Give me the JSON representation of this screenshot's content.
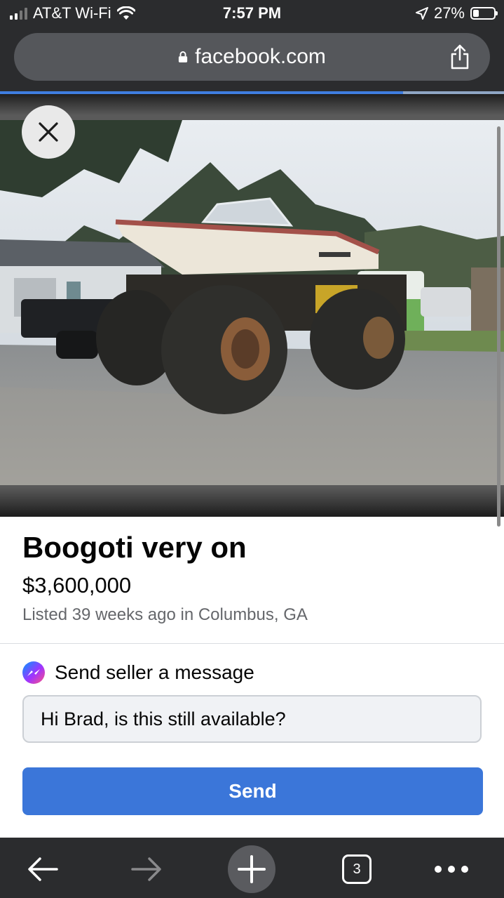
{
  "status": {
    "carrier": "AT&T Wi-Fi",
    "time": "7:57 PM",
    "battery": "27%",
    "battery_level": 0.27
  },
  "browser": {
    "url": "facebook.com",
    "page_load_progress": 0.8,
    "tab_count": "3"
  },
  "listing": {
    "title": "Boogoti very on",
    "price": "$3,600,000",
    "meta": "Listed 39 weeks ago in Columbus, GA"
  },
  "message": {
    "heading": "Send seller a message",
    "input_value": "Hi Brad, is this still available?",
    "send_label": "Send"
  },
  "colors": {
    "send_button": "#3b76d9",
    "chrome_bg": "#2b2c2e"
  },
  "icons": {
    "close": "close-icon",
    "back": "arrow-left-icon",
    "forward": "arrow-right-icon",
    "new_tab": "plus-icon",
    "more": "more-icon",
    "share": "share-icon",
    "lock": "lock-icon",
    "messenger": "messenger-icon"
  }
}
